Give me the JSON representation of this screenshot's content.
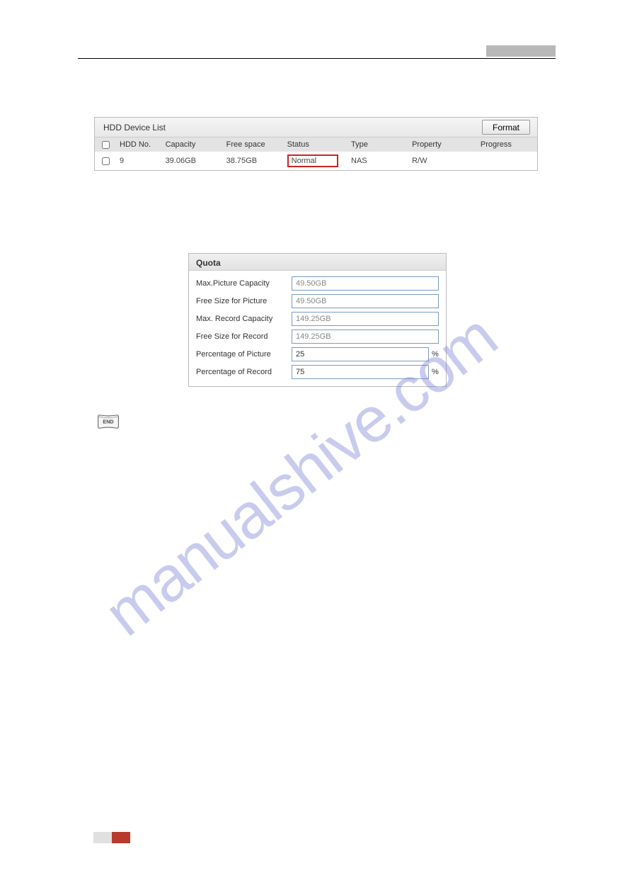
{
  "hdd": {
    "title": "HDD Device List",
    "format_btn": "Format",
    "headers": {
      "hdd_no": "HDD No.",
      "capacity": "Capacity",
      "free": "Free space",
      "status": "Status",
      "type": "Type",
      "property": "Property",
      "progress": "Progress"
    },
    "row": {
      "no": "9",
      "capacity": "39.06GB",
      "free": "38.75GB",
      "status": "Normal",
      "type": "NAS",
      "property": "R/W"
    }
  },
  "quota": {
    "title": "Quota",
    "fields": {
      "max_pic_cap": {
        "label": "Max.Picture Capacity",
        "value": "49.50GB"
      },
      "free_pic": {
        "label": "Free Size for Picture",
        "value": "49.50GB"
      },
      "max_rec_cap": {
        "label": "Max. Record Capacity",
        "value": "149.25GB"
      },
      "free_rec": {
        "label": "Free Size for Record",
        "value": "149.25GB"
      },
      "pct_pic": {
        "label": "Percentage of Picture",
        "value": "25",
        "suffix": "%"
      },
      "pct_rec": {
        "label": "Percentage of Record",
        "value": "75",
        "suffix": "%"
      }
    }
  },
  "icon": {
    "end": "END"
  },
  "watermark": "manualshive.com"
}
